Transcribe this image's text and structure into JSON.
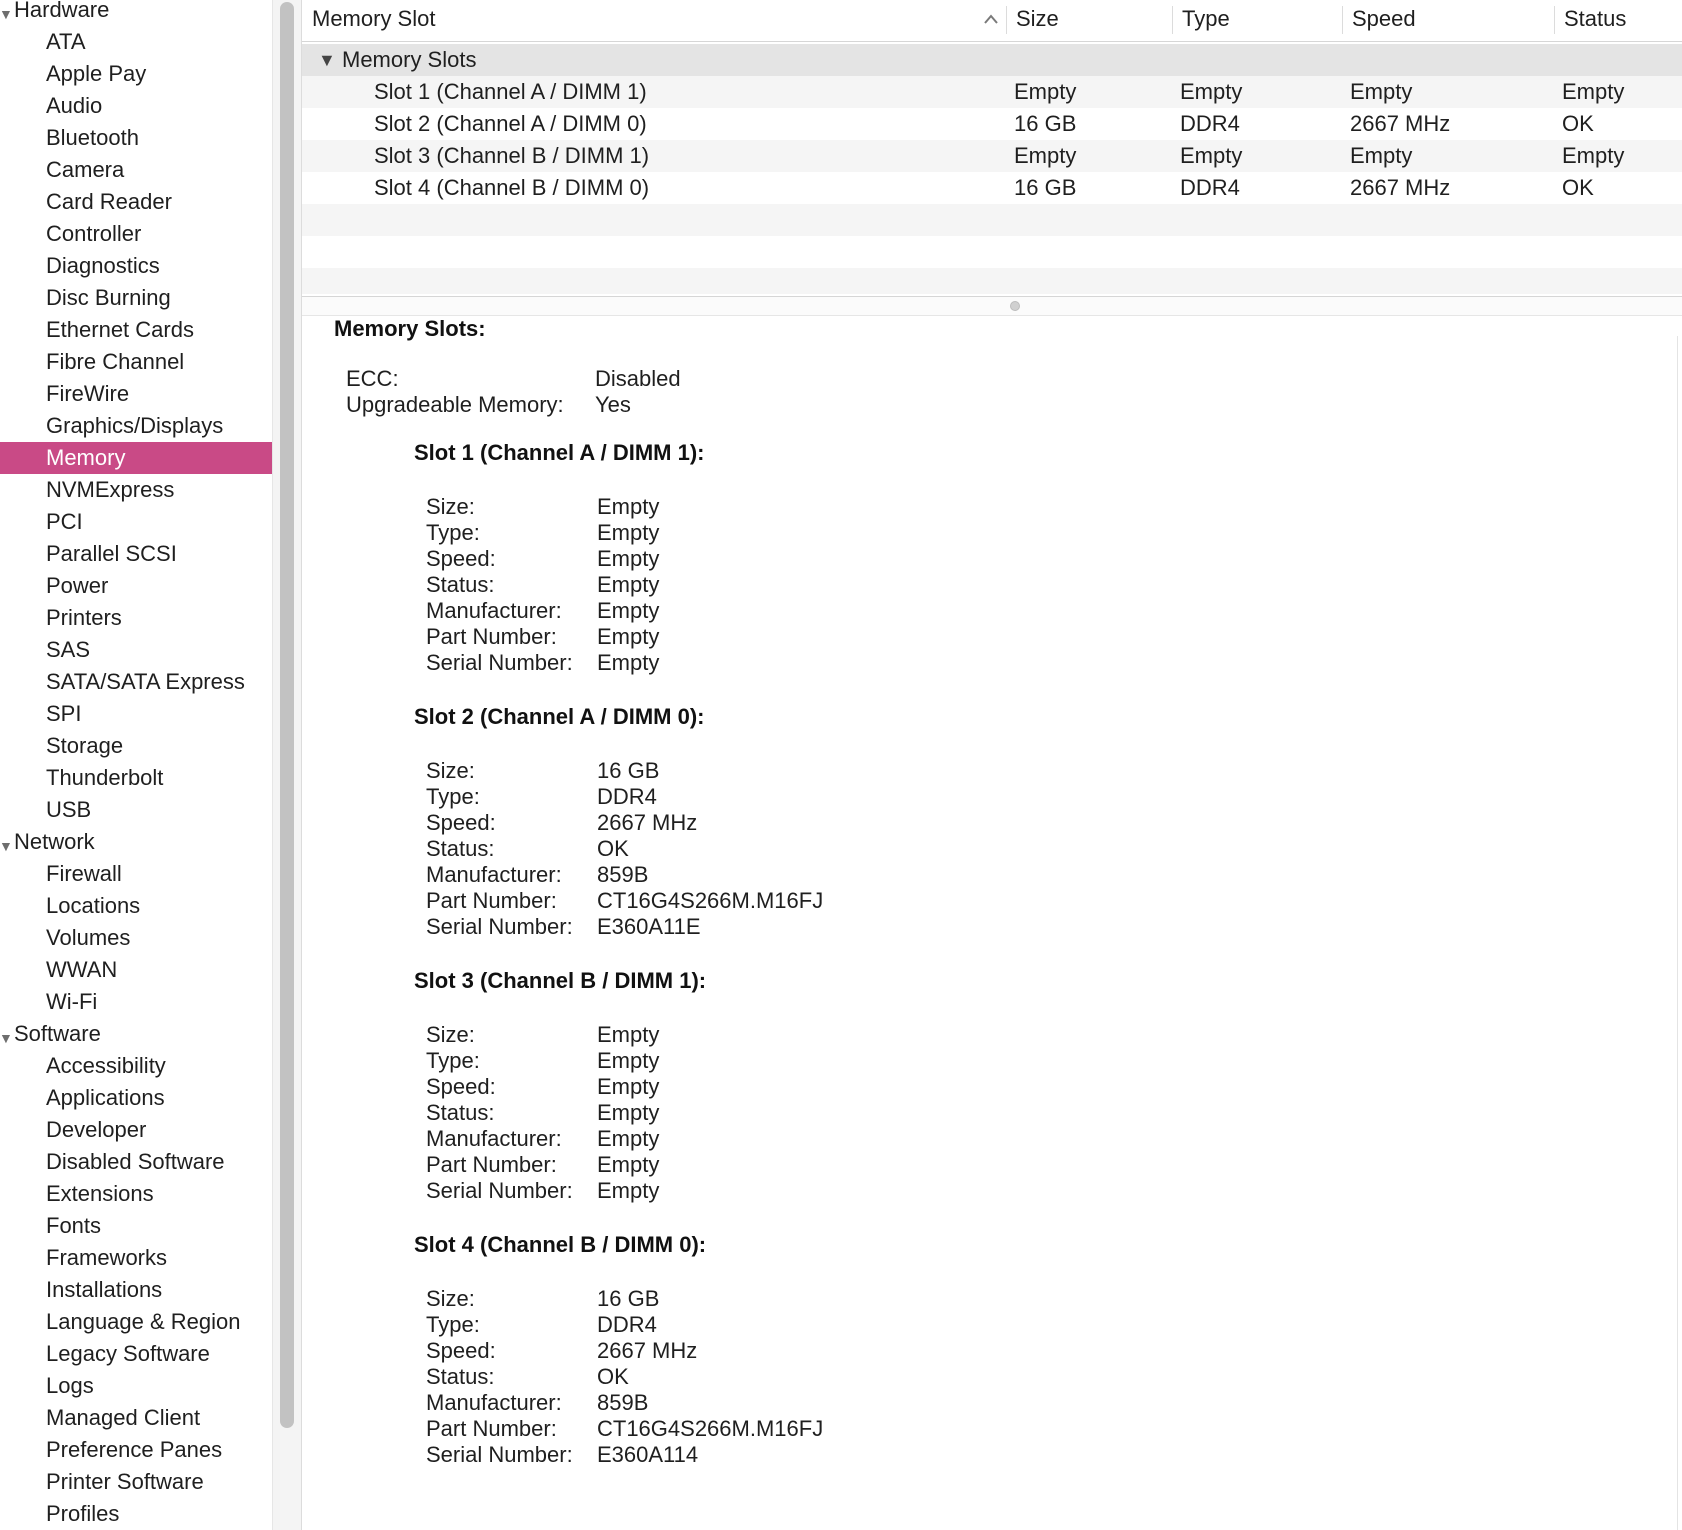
{
  "sidebar": {
    "groups": [
      {
        "label": "Hardware",
        "items": [
          "ATA",
          "Apple Pay",
          "Audio",
          "Bluetooth",
          "Camera",
          "Card Reader",
          "Controller",
          "Diagnostics",
          "Disc Burning",
          "Ethernet Cards",
          "Fibre Channel",
          "FireWire",
          "Graphics/Displays",
          "Memory",
          "NVMExpress",
          "PCI",
          "Parallel SCSI",
          "Power",
          "Printers",
          "SAS",
          "SATA/SATA Express",
          "SPI",
          "Storage",
          "Thunderbolt",
          "USB"
        ]
      },
      {
        "label": "Network",
        "items": [
          "Firewall",
          "Locations",
          "Volumes",
          "WWAN",
          "Wi-Fi"
        ]
      },
      {
        "label": "Software",
        "items": [
          "Accessibility",
          "Applications",
          "Developer",
          "Disabled Software",
          "Extensions",
          "Fonts",
          "Frameworks",
          "Installations",
          "Language & Region",
          "Legacy Software",
          "Logs",
          "Managed Client",
          "Preference Panes",
          "Printer Software",
          "Profiles"
        ]
      }
    ],
    "selected": "Memory",
    "selected_color": "#c94a86"
  },
  "table": {
    "columns": [
      "Memory Slot",
      "Size",
      "Type",
      "Speed",
      "Status"
    ],
    "sort_icon": "chevron-up-icon",
    "group_label": "Memory Slots",
    "rows": [
      {
        "slot": "Slot 1 (Channel A / DIMM 1)",
        "size": "Empty",
        "type": "Empty",
        "speed": "Empty",
        "status": "Empty"
      },
      {
        "slot": "Slot 2 (Channel A / DIMM 0)",
        "size": "16 GB",
        "type": "DDR4",
        "speed": "2667 MHz",
        "status": "OK"
      },
      {
        "slot": "Slot 3 (Channel B / DIMM 1)",
        "size": "Empty",
        "type": "Empty",
        "speed": "Empty",
        "status": "Empty"
      },
      {
        "slot": "Slot 4 (Channel B / DIMM 0)",
        "size": "16 GB",
        "type": "DDR4",
        "speed": "2667 MHz",
        "status": "OK"
      }
    ]
  },
  "detail": {
    "title": "Memory Slots:",
    "summary": [
      {
        "key": "ECC:",
        "value": "Disabled"
      },
      {
        "key": "Upgradeable Memory:",
        "value": "Yes"
      }
    ],
    "slots": [
      {
        "title": "Slot 1 (Channel A / DIMM 1):",
        "fields": [
          {
            "key": "Size:",
            "value": "Empty"
          },
          {
            "key": "Type:",
            "value": "Empty"
          },
          {
            "key": "Speed:",
            "value": "Empty"
          },
          {
            "key": "Status:",
            "value": "Empty"
          },
          {
            "key": "Manufacturer:",
            "value": "Empty"
          },
          {
            "key": "Part Number:",
            "value": "Empty"
          },
          {
            "key": "Serial Number:",
            "value": "Empty"
          }
        ]
      },
      {
        "title": "Slot 2 (Channel A / DIMM 0):",
        "fields": [
          {
            "key": "Size:",
            "value": "16 GB"
          },
          {
            "key": "Type:",
            "value": "DDR4"
          },
          {
            "key": "Speed:",
            "value": "2667 MHz"
          },
          {
            "key": "Status:",
            "value": "OK"
          },
          {
            "key": "Manufacturer:",
            "value": "859B"
          },
          {
            "key": "Part Number:",
            "value": "CT16G4S266M.M16FJ"
          },
          {
            "key": "Serial Number:",
            "value": "E360A11E"
          }
        ]
      },
      {
        "title": "Slot 3 (Channel B / DIMM 1):",
        "fields": [
          {
            "key": "Size:",
            "value": "Empty"
          },
          {
            "key": "Type:",
            "value": "Empty"
          },
          {
            "key": "Speed:",
            "value": "Empty"
          },
          {
            "key": "Status:",
            "value": "Empty"
          },
          {
            "key": "Manufacturer:",
            "value": "Empty"
          },
          {
            "key": "Part Number:",
            "value": "Empty"
          },
          {
            "key": "Serial Number:",
            "value": "Empty"
          }
        ]
      },
      {
        "title": "Slot 4 (Channel B / DIMM 0):",
        "fields": [
          {
            "key": "Size:",
            "value": "16 GB"
          },
          {
            "key": "Type:",
            "value": "DDR4"
          },
          {
            "key": "Speed:",
            "value": "2667 MHz"
          },
          {
            "key": "Status:",
            "value": "OK"
          },
          {
            "key": "Manufacturer:",
            "value": "859B"
          },
          {
            "key": "Part Number:",
            "value": "CT16G4S266M.M16FJ"
          },
          {
            "key": "Serial Number:",
            "value": "E360A114"
          }
        ]
      }
    ]
  }
}
